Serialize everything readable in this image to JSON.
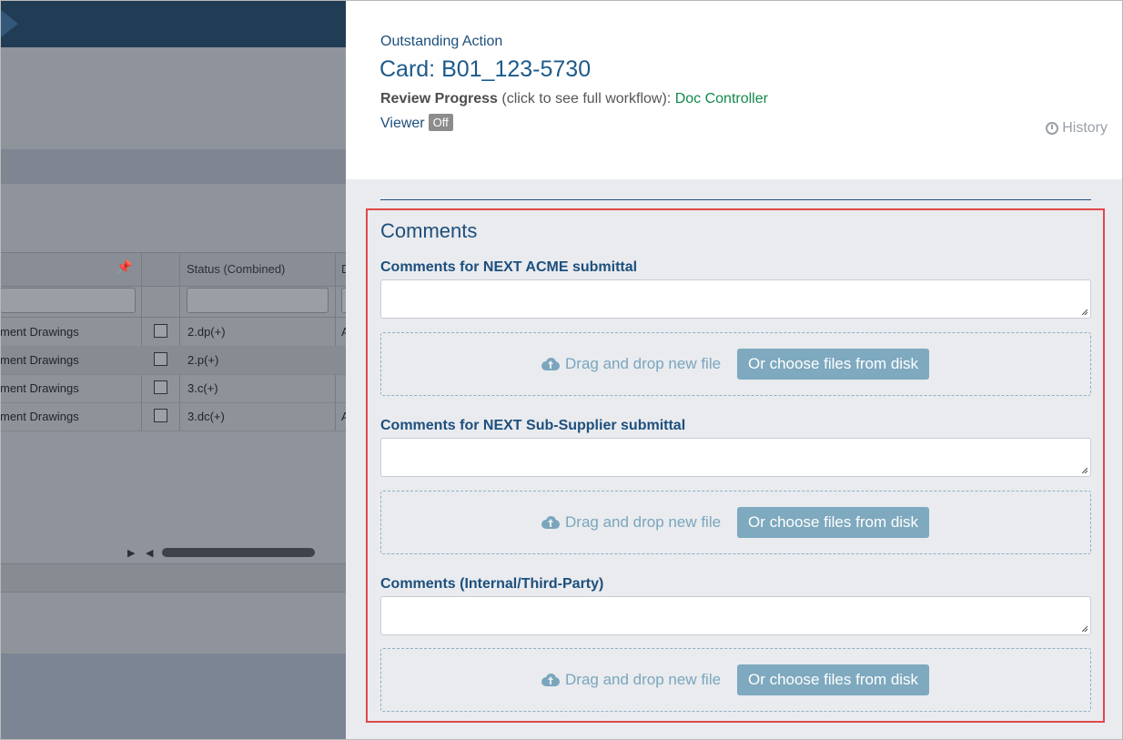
{
  "background": {
    "table": {
      "columns": [
        "Status (Combined)",
        "D"
      ],
      "rows": [
        {
          "name": "ment Drawings",
          "status": "2.dp(+)",
          "extra": "A"
        },
        {
          "name": "ment Drawings",
          "status": "2.p(+)",
          "extra": ""
        },
        {
          "name": "ment Drawings",
          "status": "3.c(+)",
          "extra": ""
        },
        {
          "name": "ment Drawings",
          "status": "3.dc(+)",
          "extra": "A"
        }
      ]
    }
  },
  "panel": {
    "subtitle": "Outstanding Action",
    "card_title": "Card: B01_123-5730",
    "review_progress_label": "Review Progress",
    "review_progress_hint": "(click to see full workflow):",
    "review_progress_value": "Doc Controller",
    "viewer_label": "Viewer",
    "viewer_toggle": "Off",
    "history_label": "History",
    "comments": {
      "title": "Comments",
      "fields": [
        {
          "label": "Comments for NEXT ACME submittal",
          "value": "",
          "drop_text": "Drag and drop new file",
          "button": "Or choose files from disk"
        },
        {
          "label": "Comments for NEXT Sub-Supplier submittal",
          "value": "",
          "drop_text": "Drag and drop new file",
          "button": "Or choose files from disk"
        },
        {
          "label": "Comments (Internal/Third-Party)",
          "value": "",
          "drop_text": "Drag and drop new file",
          "button": "Or choose files from disk"
        }
      ]
    }
  },
  "colors": {
    "accent": "#1d4f7c",
    "link_green": "#13894b",
    "highlight_border": "#e04848",
    "upload_button": "#7ea9bf"
  }
}
